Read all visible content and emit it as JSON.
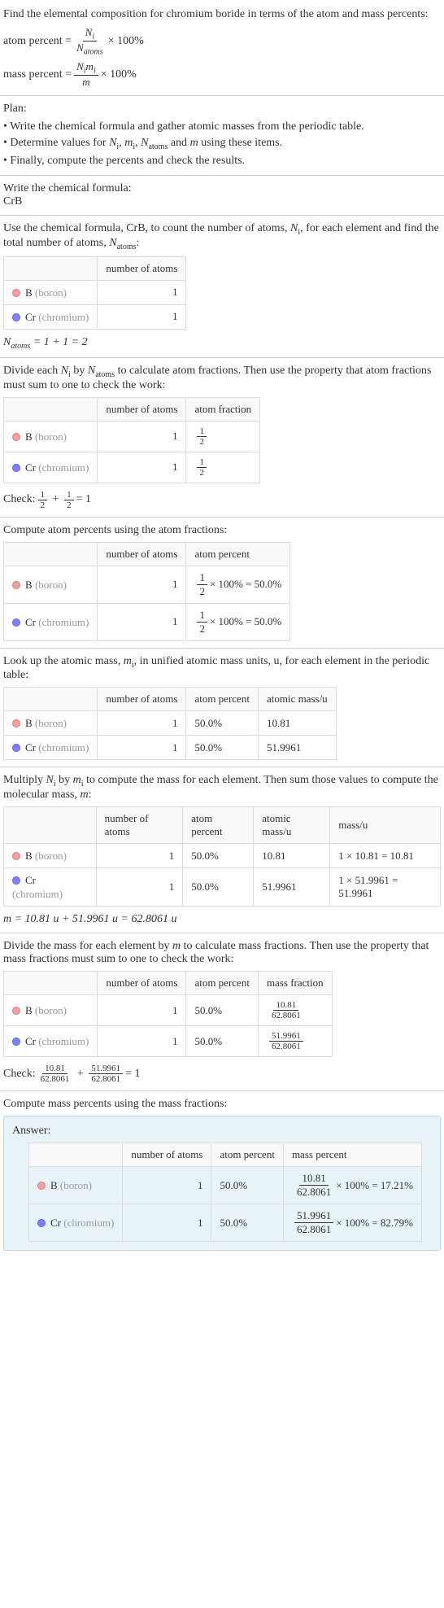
{
  "intro": {
    "line1": "Find the elemental composition for chromium boride in terms of the atom and mass percents:",
    "atom_percent_label": "atom percent = ",
    "atom_frac_num": "N_i",
    "atom_frac_den": "N_atoms",
    "times100": " × 100%",
    "mass_percent_label": "mass percent = ",
    "mass_frac_num": "N_i m_i",
    "mass_frac_den": "m"
  },
  "plan": {
    "title": "Plan:",
    "items": [
      "• Write the chemical formula and gather atomic masses from the periodic table.",
      "• Determine values for N_i, m_i, N_atoms and m using these items.",
      "• Finally, compute the percents and check the results."
    ]
  },
  "s1": {
    "title": "Write the chemical formula:",
    "formula": "CrB"
  },
  "s2": {
    "text": "Use the chemical formula, CrB, to count the number of atoms, N_i, for each element and find the total number of atoms, N_atoms:",
    "h_num": "number of atoms",
    "b_label": "B",
    "b_paren": "(boron)",
    "b_n": "1",
    "cr_label": "Cr",
    "cr_paren": "(chromium)",
    "cr_n": "1",
    "sum": "N_atoms = 1 + 1 = 2"
  },
  "s3": {
    "text": "Divide each N_i by N_atoms to calculate atom fractions. Then use the property that atom fractions must sum to one to check the work:",
    "h_frac": "atom fraction",
    "b_frac_num": "1",
    "b_frac_den": "2",
    "cr_frac_num": "1",
    "cr_frac_den": "2",
    "check_label": "Check: ",
    "check_eq": " = 1"
  },
  "s4": {
    "text": "Compute atom percents using the atom fractions:",
    "h_pct": "atom percent",
    "b_pct": " × 100% = 50.0%",
    "cr_pct": " × 100% = 50.0%"
  },
  "s5": {
    "text": "Look up the atomic mass, m_i, in unified atomic mass units, u, for each element in the periodic table:",
    "h_mass": "atomic mass/u",
    "b_mass": "10.81",
    "cr_mass": "51.9961",
    "b_pct_val": "50.0%",
    "cr_pct_val": "50.0%"
  },
  "s6": {
    "text": "Multiply N_i by m_i to compute the mass for each element. Then sum those values to compute the molecular mass, m:",
    "h_massu": "mass/u",
    "b_calc": "1 × 10.81 = 10.81",
    "cr_calc": "1 × 51.9961 = 51.9961",
    "sum": "m = 10.81 u + 51.9961 u = 62.8061 u"
  },
  "s7": {
    "text": "Divide the mass for each element by m to calculate mass fractions. Then use the property that mass fractions must sum to one to check the work:",
    "h_mf": "mass fraction",
    "b_mf_num": "10.81",
    "b_mf_den": "62.8061",
    "cr_mf_num": "51.9961",
    "cr_mf_den": "62.8061",
    "check_label": "Check: ",
    "check_eq": " = 1"
  },
  "s8": {
    "text": "Compute mass percents using the mass fractions:",
    "answer_label": "Answer:",
    "h_mp": "mass percent",
    "b_mp": " × 100% = 17.21%",
    "cr_mp": " × 100% = 82.79%"
  },
  "chart_data": {
    "type": "table",
    "elements": [
      {
        "symbol": "B",
        "name": "boron",
        "atoms": 1,
        "atom_fraction": 0.5,
        "atom_percent": 50.0,
        "atomic_mass_u": 10.81,
        "mass_u": 10.81,
        "mass_fraction_num": 10.81,
        "mass_fraction_den": 62.8061,
        "mass_percent": 17.21
      },
      {
        "symbol": "Cr",
        "name": "chromium",
        "atoms": 1,
        "atom_fraction": 0.5,
        "atom_percent": 50.0,
        "atomic_mass_u": 51.9961,
        "mass_u": 51.9961,
        "mass_fraction_num": 51.9961,
        "mass_fraction_den": 62.8061,
        "mass_percent": 82.79
      }
    ],
    "N_atoms": 2,
    "molecular_mass_u": 62.8061
  }
}
